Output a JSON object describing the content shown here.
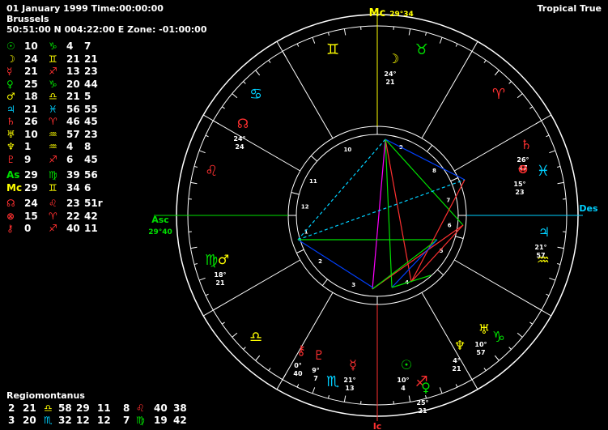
{
  "header": {
    "datetime": "01 January 1999 Time:00:00:00",
    "place": "Brussels",
    "coords": "50:51:00 N 004:22:00 E  Zone: -01:00:00",
    "mode": "Tropical True"
  },
  "positions": [
    {
      "body": "☉",
      "sign": "♑",
      "deg": "10",
      "min": "4",
      "sec": "7",
      "bodyColor": "#00e000",
      "signColor": "#00e000"
    },
    {
      "body": "☽",
      "sign": "♊",
      "deg": "24",
      "min": "21",
      "sec": "21",
      "bodyColor": "#ffff00",
      "signColor": "#ffff00"
    },
    {
      "body": "☿",
      "sign": "♐",
      "deg": "21",
      "min": "13",
      "sec": "23",
      "bodyColor": "#ff3030",
      "signColor": "#ff3030"
    },
    {
      "body": "♀",
      "sign": "♑",
      "deg": "25",
      "min": "20",
      "sec": "44",
      "bodyColor": "#00e000",
      "signColor": "#00e000"
    },
    {
      "body": "♂",
      "sign": "♎",
      "deg": "18",
      "min": "21",
      "sec": "5",
      "bodyColor": "#ffff00",
      "signColor": "#ffff00"
    },
    {
      "body": "♃",
      "sign": "♓",
      "deg": "21",
      "min": "56",
      "sec": "55",
      "bodyColor": "#00d0ff",
      "signColor": "#00d0ff"
    },
    {
      "body": "♄",
      "sign": "♈",
      "deg": "26",
      "min": "46",
      "sec": "45",
      "bodyColor": "#ff3030",
      "signColor": "#ff3030"
    },
    {
      "body": "♅",
      "sign": "♒",
      "deg": "10",
      "min": "57",
      "sec": "23",
      "bodyColor": "#ffff00",
      "signColor": "#ffff00"
    },
    {
      "body": "♆",
      "sign": "♒",
      "deg": "1",
      "min": "4",
      "sec": "8",
      "bodyColor": "#ffff00",
      "signColor": "#ffff00"
    },
    {
      "body": "♇",
      "sign": "♐",
      "deg": "9",
      "min": "6",
      "sec": "45",
      "bodyColor": "#ff3030",
      "signColor": "#ff3030"
    },
    {
      "body": "As",
      "sign": "♍",
      "deg": "29",
      "min": "39",
      "sec": "56",
      "bodyColor": "#00e000",
      "signColor": "#00e000"
    },
    {
      "body": "Mc",
      "sign": "♊",
      "deg": "29",
      "min": "34",
      "sec": "6",
      "bodyColor": "#ffff00",
      "signColor": "#ffff00"
    },
    {
      "body": "☊",
      "sign": "♌",
      "deg": "24",
      "min": "23",
      "sec": "51r",
      "bodyColor": "#ff3030",
      "signColor": "#ff3030"
    },
    {
      "body": "⊗",
      "sign": "♈",
      "deg": "15",
      "min": "22",
      "sec": "42",
      "bodyColor": "#ff3030",
      "signColor": "#ff3030"
    },
    {
      "body": "⚷",
      "sign": "♐",
      "deg": "0",
      "min": "40",
      "sec": "11",
      "bodyColor": "#ff3030",
      "signColor": "#ff3030"
    }
  ],
  "houses": {
    "title": "Regiomontanus",
    "rows": [
      {
        "h1": "2",
        "d1": "21",
        "s1": "♎",
        "m1": "58",
        "h2": "29",
        "d2": "11",
        "h3": "8",
        "s2": "♌",
        "m2": "40",
        "x2": "38",
        "c1": "#ffff00",
        "c2": "#ff3030"
      },
      {
        "h1": "3",
        "d1": "20",
        "s1": "♏",
        "m1": "32",
        "h2": "12",
        "d2": "12",
        "h3": "7",
        "s2": "♍",
        "m2": "19",
        "x2": "42",
        "c1": "#00d0ff",
        "c2": "#00e000"
      }
    ]
  },
  "chart": {
    "asc_label": "Asc",
    "asc_value": "29°40",
    "des_label": "Des",
    "mc_label": "Mc",
    "mc_value": "29°34",
    "ic_label": "Ic",
    "house_numbers": [
      "1",
      "2",
      "3",
      "4",
      "5",
      "6",
      "7",
      "8",
      "9",
      "10",
      "11",
      "12"
    ],
    "zodiac_signs": [
      {
        "glyph": "♋",
        "color": "#00d0ff"
      },
      {
        "glyph": "♊",
        "color": "#ffff00"
      },
      {
        "glyph": "♉",
        "color": "#00e000"
      },
      {
        "glyph": "♈",
        "color": "#ff3030"
      },
      {
        "glyph": "♓",
        "color": "#00d0ff"
      },
      {
        "glyph": "♒",
        "color": "#ffff00"
      },
      {
        "glyph": "♑",
        "color": "#00e000"
      },
      {
        "glyph": "♐",
        "color": "#ff3030"
      },
      {
        "glyph": "♏",
        "color": "#00d0ff"
      },
      {
        "glyph": "♎",
        "color": "#ffff00"
      },
      {
        "glyph": "♍",
        "color": "#00e000"
      },
      {
        "glyph": "♌",
        "color": "#ff3030"
      }
    ],
    "planet_labels": [
      {
        "glyph": "☽",
        "color": "#ffff00",
        "deg": "24°",
        "min": "21"
      },
      {
        "glyph": "♄",
        "color": "#ff3030",
        "deg": "26°",
        "min": "47"
      },
      {
        "glyph": "⊗",
        "color": "#ff3030",
        "deg": "15°",
        "min": "23"
      },
      {
        "glyph": "♃",
        "color": "#00d0ff",
        "deg": "21°",
        "min": "57"
      },
      {
        "glyph": "♅",
        "color": "#ffff00",
        "deg": "10°",
        "min": "57"
      },
      {
        "glyph": "♆",
        "color": "#ffff00",
        "deg": "4°",
        "min": "21"
      },
      {
        "glyph": "♀",
        "color": "#00e000",
        "deg": "25°",
        "min": "21"
      },
      {
        "glyph": "☉",
        "color": "#00e000",
        "deg": "10°",
        "min": "4"
      },
      {
        "glyph": "☿",
        "color": "#ff3030",
        "deg": "21°",
        "min": "13"
      },
      {
        "glyph": "♇",
        "color": "#ff3030",
        "deg": "9°",
        "min": "7"
      },
      {
        "glyph": "⚷",
        "color": "#ff3030",
        "deg": "0°",
        "min": "40"
      },
      {
        "glyph": "♂",
        "color": "#ffff00",
        "deg": "18°",
        "min": "21"
      },
      {
        "glyph": "☊",
        "color": "#ff3030",
        "deg": "24°",
        "min": "24"
      }
    ]
  }
}
